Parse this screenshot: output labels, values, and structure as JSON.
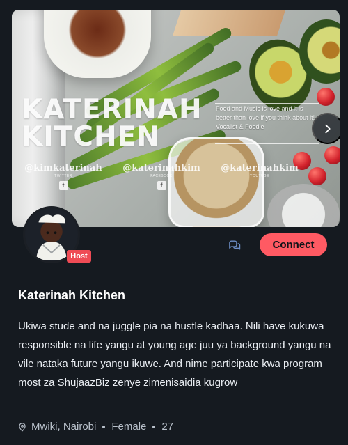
{
  "banner": {
    "title": "KATERINAH\nKITCHEN",
    "description": "Food and Music is love and it is better than love if you think about it! Vocalist & Foodie",
    "handles": [
      {
        "text": "@kimkaterinah",
        "platform": "TWITTER",
        "icon": "twitter-icon"
      },
      {
        "text": "@katerinahkim",
        "platform": "FACEBOOK",
        "icon": "facebook-icon"
      },
      {
        "text": "@katerinahkim",
        "platform": "YOUTUBE",
        "icon": "youtube-icon"
      }
    ],
    "next_icon": "chevron-right-icon"
  },
  "profile": {
    "badge": "Host",
    "connect_label": "Connect",
    "name": "Katerinah Kitchen",
    "bio": "Ukiwa stude and na juggle pia na hustle kadhaa. Nili have kukuwa responsible na life yangu at young age juu ya background yangu na vile nataka future yangu ikuwe. And nime participate kwa program most za ShujaazBiz zenye zimenisaidia kugrow",
    "location": "Mwiki, Nairobi",
    "gender": "Female",
    "age": "27"
  },
  "icons": {
    "chat": "chat-icon",
    "location": "location-pin-icon"
  },
  "colors": {
    "background": "#151a20",
    "accent": "#ff5a63",
    "badge": "#ef4b55",
    "text": "#e9edf2",
    "muted": "#b8c0ca"
  }
}
